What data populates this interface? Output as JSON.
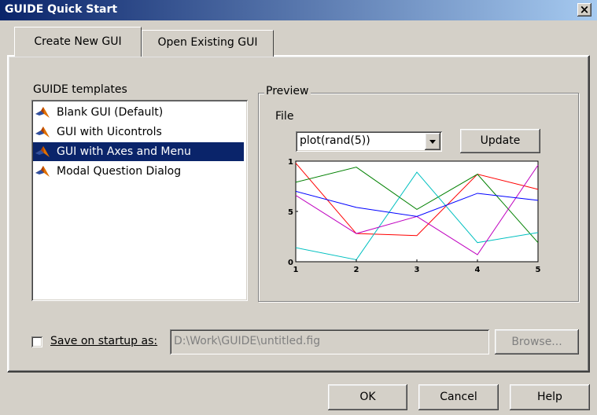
{
  "window": {
    "title": "GUIDE Quick Start",
    "close_label": "×"
  },
  "tabs": [
    {
      "label": "Create New GUI",
      "active": true
    },
    {
      "label": "Open Existing GUI",
      "active": false
    }
  ],
  "templates": {
    "label": "GUIDE templates",
    "items": [
      {
        "label": "Blank GUI (Default)",
        "icon": "matlab-icon",
        "selected": false
      },
      {
        "label": "GUI with Uicontrols",
        "icon": "matlab-icon",
        "selected": false
      },
      {
        "label": "GUI with Axes and Menu",
        "icon": "matlab-icon",
        "selected": true
      },
      {
        "label": "Modal Question Dialog",
        "icon": "matlab-icon",
        "selected": false
      }
    ]
  },
  "preview": {
    "label": "Preview",
    "file_label": "File",
    "popup_value": "plot(rand(5))",
    "update_label": "Update"
  },
  "chart_data": {
    "type": "line",
    "x": [
      1,
      2,
      3,
      4,
      5
    ],
    "xticks": [
      "1",
      "2",
      "3",
      "4",
      "5"
    ],
    "yticks": [
      "0",
      "0.5",
      "1"
    ],
    "xlim": [
      1,
      5
    ],
    "ylim": [
      0,
      1
    ],
    "series": [
      {
        "color": "#ff0000",
        "values": [
          0.98,
          0.28,
          0.26,
          0.87,
          0.72
        ]
      },
      {
        "color": "#008000",
        "values": [
          0.79,
          0.94,
          0.52,
          0.87,
          0.19
        ]
      },
      {
        "color": "#00c0c0",
        "values": [
          0.14,
          0.02,
          0.89,
          0.19,
          0.29
        ]
      },
      {
        "color": "#bf00bf",
        "values": [
          0.66,
          0.28,
          0.45,
          0.07,
          0.96
        ]
      },
      {
        "color": "#0000ff",
        "values": [
          0.7,
          0.54,
          0.45,
          0.68,
          0.61
        ]
      }
    ]
  },
  "save": {
    "checked": false,
    "label": "Save on startup as:",
    "path": "D:\\Work\\GUIDE\\untitled.fig",
    "browse_label": "Browse..."
  },
  "buttons": {
    "ok": "OK",
    "cancel": "Cancel",
    "help": "Help"
  }
}
